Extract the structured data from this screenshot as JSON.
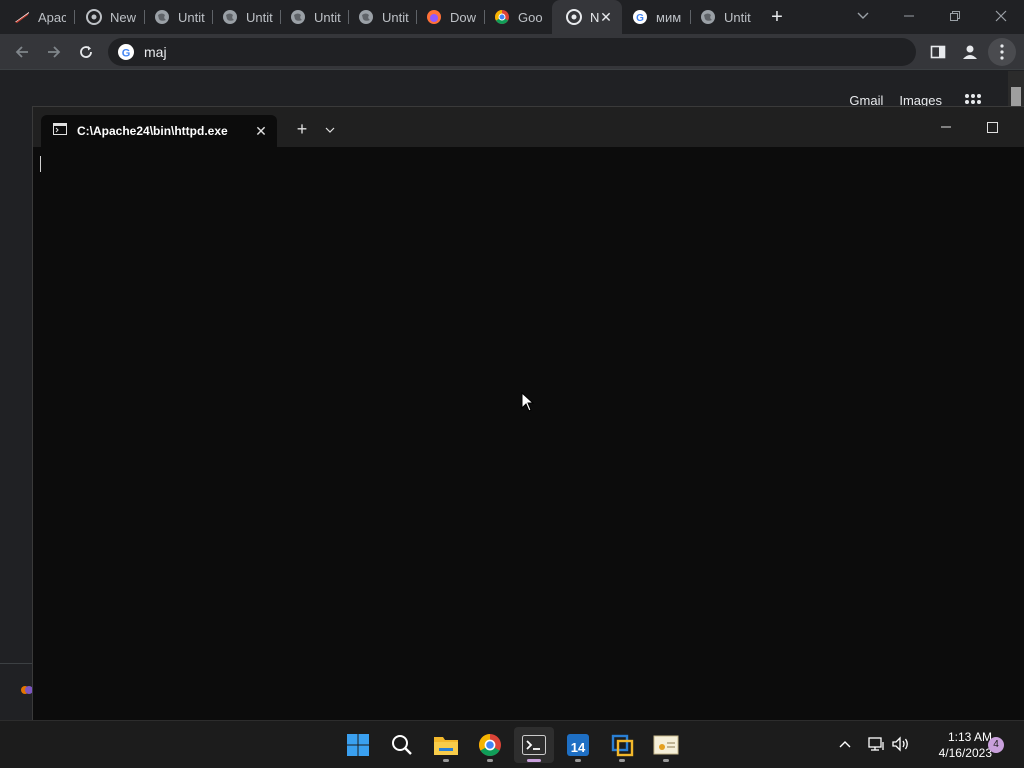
{
  "browser": {
    "tabs": [
      {
        "label": "Apac",
        "icon": "apache-feather-icon"
      },
      {
        "label": "New",
        "icon": "chrome-icon"
      },
      {
        "label": "Untit",
        "icon": "globe-icon"
      },
      {
        "label": "Untit",
        "icon": "globe-icon"
      },
      {
        "label": "Untit",
        "icon": "globe-icon"
      },
      {
        "label": "Untit",
        "icon": "globe-icon"
      },
      {
        "label": "Dow",
        "icon": "firefox-icon"
      },
      {
        "label": "Goo",
        "icon": "google-chrome-icon"
      },
      {
        "label": "N",
        "icon": "chrome-icon",
        "active": true
      },
      {
        "label": "мим",
        "icon": "google-icon"
      },
      {
        "label": "Untit",
        "icon": "globe-icon"
      }
    ],
    "new_tab_symbol": "+",
    "close_symbol": "✕",
    "address": "maj"
  },
  "page": {
    "gmail": "Gmail",
    "images": "Images"
  },
  "terminal": {
    "tab_title": "C:\\Apache24\\bin\\httpd.exe",
    "close_symbol": "✕",
    "add_symbol": "+"
  },
  "taskbar": {
    "apps": [
      "windows-start-icon",
      "search-icon",
      "file-explorer-icon",
      "chrome-icon",
      "terminal-icon",
      "app-14-icon",
      "virtualbox-icon",
      "certificate-app-icon"
    ],
    "time": "1:13 AM",
    "date": "4/16/2023",
    "notifications": "4"
  }
}
